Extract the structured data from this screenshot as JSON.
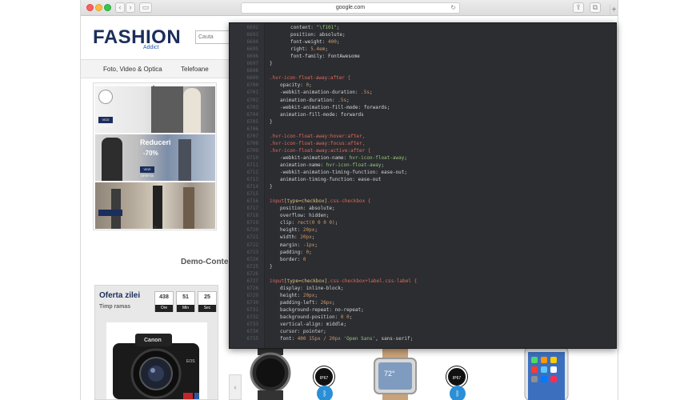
{
  "browser": {
    "url": "google.com",
    "back_glyph": "‹",
    "forward_glyph": "›",
    "sidebar_glyph": "▭",
    "reload_glyph": "↻",
    "share_glyph": "⇪",
    "tabs_glyph": "⧉",
    "newtab_glyph": "+"
  },
  "site": {
    "logo": "FASHION",
    "logo_sub": "Addict",
    "search_placeholder": "Cauta",
    "menu": [
      "Foto, Video & Optica",
      "Telefoane"
    ],
    "slides": [
      {
        "badge": "VEZI OFERTA",
        "text": ""
      },
      {
        "badge": "VEZI OFERTA",
        "text": "Reduceri",
        "text2": "-70%"
      },
      {
        "badge": "",
        "text": ""
      }
    ],
    "arrow_up": "^",
    "arrow_down": "⌄",
    "demo_title": "Demo-Conte",
    "deal": {
      "title": "Oferta zilei",
      "subtitle": "Timp ramas",
      "timer": [
        {
          "value": "438",
          "label": "Ore"
        },
        {
          "value": "51",
          "label": "Min"
        },
        {
          "value": "25",
          "label": "Sec"
        }
      ],
      "camera_brand": "Canon",
      "camera_model": "EOS"
    },
    "products": {
      "badge1": "IP67",
      "badge2": "IP67",
      "watch_time": "72°",
      "prev": "‹",
      "next": "›",
      "bt_glyph": "ᛒ"
    }
  },
  "editor": {
    "lines": [
      {
        "n": "6692",
        "i": 2,
        "parts": [
          [
            "prop",
            "content: "
          ],
          [
            "str",
            "\"\\f101\""
          ],
          [
            "plain",
            ";"
          ]
        ]
      },
      {
        "n": "6693",
        "i": 2,
        "parts": [
          [
            "prop",
            "position: absolute;"
          ]
        ]
      },
      {
        "n": "6694",
        "i": 2,
        "parts": [
          [
            "prop",
            "font-weight: "
          ],
          [
            "val",
            "400"
          ],
          [
            "plain",
            ";"
          ]
        ]
      },
      {
        "n": "6695",
        "i": 2,
        "parts": [
          [
            "prop",
            "right: "
          ],
          [
            "val",
            "5.4em"
          ],
          [
            "plain",
            ";"
          ]
        ]
      },
      {
        "n": "6696",
        "i": 2,
        "parts": [
          [
            "prop",
            "font-family: FontAwesome"
          ]
        ]
      },
      {
        "n": "6697",
        "i": 0,
        "parts": [
          [
            "plain",
            "}"
          ]
        ]
      },
      {
        "n": "6698",
        "i": 0,
        "parts": []
      },
      {
        "n": "6699",
        "i": 0,
        "parts": [
          [
            "sel",
            ".hvr-icon-float-away:after {"
          ]
        ]
      },
      {
        "n": "6700",
        "i": 1,
        "parts": [
          [
            "prop",
            "opacity: "
          ],
          [
            "val",
            "0"
          ],
          [
            "plain",
            ";"
          ]
        ]
      },
      {
        "n": "6701",
        "i": 1,
        "parts": [
          [
            "prop",
            "-webkit-animation-duration: "
          ],
          [
            "val",
            ".5s"
          ],
          [
            "plain",
            ";"
          ]
        ]
      },
      {
        "n": "6702",
        "i": 1,
        "parts": [
          [
            "prop",
            "animation-duration: "
          ],
          [
            "val",
            ".5s"
          ],
          [
            "plain",
            ";"
          ]
        ]
      },
      {
        "n": "6703",
        "i": 1,
        "parts": [
          [
            "prop",
            "-webkit-animation-fill-mode: forwards;"
          ]
        ]
      },
      {
        "n": "6704",
        "i": 1,
        "parts": [
          [
            "prop",
            "animation-fill-mode: forwards"
          ]
        ]
      },
      {
        "n": "6705",
        "i": 0,
        "parts": [
          [
            "plain",
            "}"
          ]
        ]
      },
      {
        "n": "6706",
        "i": 0,
        "parts": []
      },
      {
        "n": "6707",
        "i": 0,
        "parts": [
          [
            "sel",
            ".hvr-icon-float-away:hover:after,"
          ]
        ]
      },
      {
        "n": "6708",
        "i": 0,
        "parts": [
          [
            "sel",
            ".hvr-icon-float-away:focus:after,"
          ]
        ]
      },
      {
        "n": "6709",
        "i": 0,
        "parts": [
          [
            "sel",
            ".hvr-icon-float-away:active:after {"
          ]
        ]
      },
      {
        "n": "6710",
        "i": 1,
        "parts": [
          [
            "prop",
            "-webkit-animation-name: "
          ],
          [
            "str",
            "hvr-icon-float-away"
          ],
          [
            "plain",
            ";"
          ]
        ]
      },
      {
        "n": "6711",
        "i": 1,
        "parts": [
          [
            "prop",
            "animation-name: "
          ],
          [
            "str",
            "hvr-icon-float-away"
          ],
          [
            "plain",
            ";"
          ]
        ]
      },
      {
        "n": "6712",
        "i": 1,
        "parts": [
          [
            "prop",
            "-webkit-animation-timing-function: ease-out;"
          ]
        ]
      },
      {
        "n": "6713",
        "i": 1,
        "parts": [
          [
            "prop",
            "animation-timing-function: ease-out"
          ]
        ]
      },
      {
        "n": "6714",
        "i": 0,
        "parts": [
          [
            "plain",
            "}"
          ]
        ]
      },
      {
        "n": "6715",
        "i": 0,
        "parts": []
      },
      {
        "n": "6716",
        "i": 0,
        "parts": [
          [
            "sel",
            "input"
          ],
          [
            "kw",
            "[type=checkbox]"
          ],
          [
            "sel",
            ".css-checkbox {"
          ]
        ]
      },
      {
        "n": "6717",
        "i": 1,
        "parts": [
          [
            "prop",
            "position: absolute;"
          ]
        ]
      },
      {
        "n": "6718",
        "i": 1,
        "parts": [
          [
            "prop",
            "overflow: hidden;"
          ]
        ]
      },
      {
        "n": "6719",
        "i": 1,
        "parts": [
          [
            "prop",
            "clip: "
          ],
          [
            "val",
            "rect(0 0 0 0)"
          ],
          [
            "plain",
            ";"
          ]
        ]
      },
      {
        "n": "6720",
        "i": 1,
        "parts": [
          [
            "prop",
            "height: "
          ],
          [
            "val",
            "20px"
          ],
          [
            "plain",
            ";"
          ]
        ]
      },
      {
        "n": "6721",
        "i": 1,
        "parts": [
          [
            "prop",
            "width: "
          ],
          [
            "val",
            "20px"
          ],
          [
            "plain",
            ";"
          ]
        ]
      },
      {
        "n": "6722",
        "i": 1,
        "parts": [
          [
            "prop",
            "margin: "
          ],
          [
            "val",
            "-1px"
          ],
          [
            "plain",
            ";"
          ]
        ]
      },
      {
        "n": "6723",
        "i": 1,
        "parts": [
          [
            "prop",
            "padding: "
          ],
          [
            "val",
            "0"
          ],
          [
            "plain",
            ";"
          ]
        ]
      },
      {
        "n": "6724",
        "i": 1,
        "parts": [
          [
            "prop",
            "border: "
          ],
          [
            "val",
            "0"
          ]
        ]
      },
      {
        "n": "6725",
        "i": 0,
        "parts": [
          [
            "plain",
            "}"
          ]
        ]
      },
      {
        "n": "6726",
        "i": 0,
        "parts": []
      },
      {
        "n": "6727",
        "i": 0,
        "parts": [
          [
            "sel",
            "input"
          ],
          [
            "kw",
            "[type=checkbox]"
          ],
          [
            "sel",
            ".css-checkbox+label.css-label {"
          ]
        ]
      },
      {
        "n": "6728",
        "i": 1,
        "parts": [
          [
            "prop",
            "display: inline-block;"
          ]
        ]
      },
      {
        "n": "6729",
        "i": 1,
        "parts": [
          [
            "prop",
            "height: "
          ],
          [
            "val",
            "20px"
          ],
          [
            "plain",
            ";"
          ]
        ]
      },
      {
        "n": "6730",
        "i": 1,
        "parts": [
          [
            "prop",
            "padding-left: "
          ],
          [
            "val",
            "26px"
          ],
          [
            "plain",
            ";"
          ]
        ]
      },
      {
        "n": "6731",
        "i": 1,
        "parts": [
          [
            "prop",
            "background-repeat: no-repeat;"
          ]
        ]
      },
      {
        "n": "6732",
        "i": 1,
        "parts": [
          [
            "prop",
            "background-position: "
          ],
          [
            "val",
            "0 0"
          ],
          [
            "plain",
            ";"
          ]
        ]
      },
      {
        "n": "6733",
        "i": 1,
        "parts": [
          [
            "prop",
            "vertical-align: middle;"
          ]
        ]
      },
      {
        "n": "6734",
        "i": 1,
        "parts": [
          [
            "prop",
            "cursor: pointer;"
          ]
        ]
      },
      {
        "n": "6735",
        "i": 1,
        "parts": [
          [
            "prop",
            "font: "
          ],
          [
            "val",
            "400 15px / 20px "
          ],
          [
            "str",
            "'Open Sans'"
          ],
          [
            "plain",
            ", sans-serif;"
          ]
        ]
      }
    ]
  }
}
